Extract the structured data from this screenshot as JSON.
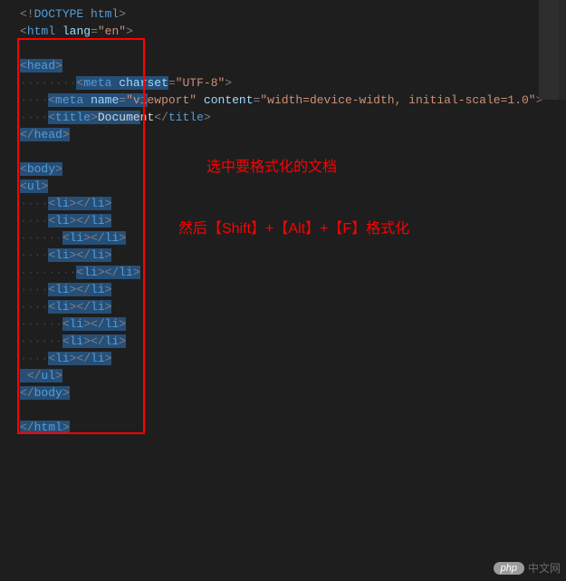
{
  "annotations": {
    "line1": "选中要格式化的文档",
    "line2": "然后【Shift】+【Alt】+【F】格式化"
  },
  "watermark": {
    "badge": "php",
    "text": "中文网"
  },
  "code": {
    "doctype": "DOCTYPE html",
    "html_open": "html",
    "lang_attr": "lang",
    "lang_val": "\"en\"",
    "head": "head",
    "meta": "meta",
    "charset_attr": "charset",
    "charset_val": "\"UTF-8\"",
    "name_attr": "name",
    "name_val": "\"viewport\"",
    "content_attr": "content",
    "content_val": "\"width=device-width, initial-scale=1.0\"",
    "title": "title",
    "title_text": "Document",
    "body": "body",
    "ul": "ul",
    "li": "li",
    "html_close": "html"
  },
  "dots": {
    "d4": "····",
    "d6": "······",
    "d8": "········"
  }
}
